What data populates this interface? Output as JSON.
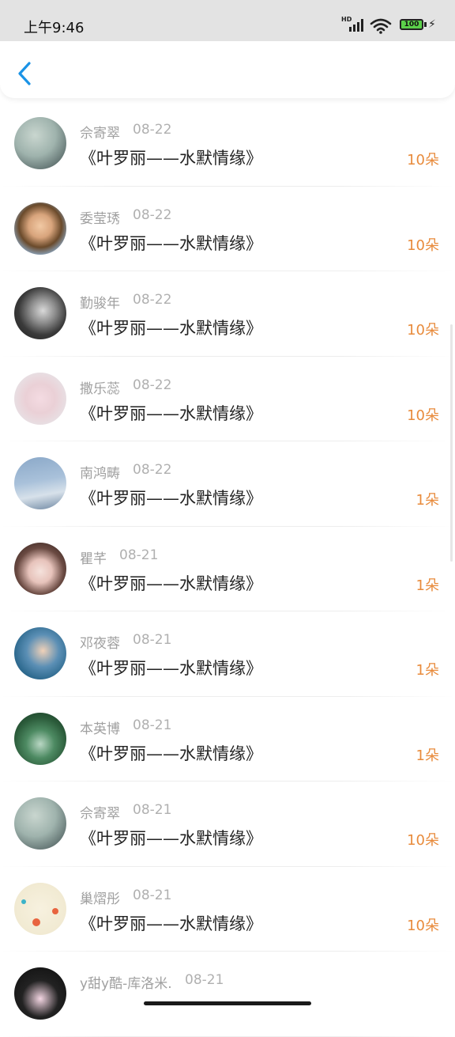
{
  "status": {
    "time": "上午9:46",
    "hd": "HD",
    "battery": "100",
    "icons": [
      "signal-icon",
      "wifi-icon",
      "battery-icon",
      "charging-icon"
    ]
  },
  "header": {
    "back_icon": "chevron-left-icon",
    "accent": "#1a93e6"
  },
  "colors": {
    "count": "#e88b3c",
    "name": "#a0a0a0",
    "title": "#222222"
  },
  "items": [
    {
      "name": "佘寄翠",
      "date": "08-22",
      "title": "《叶罗丽——水默情缘》",
      "count": "10朵",
      "avatar": "sky"
    },
    {
      "name": "委莹琇",
      "date": "08-22",
      "title": "《叶罗丽——水默情缘》",
      "count": "10朵",
      "avatar": "boy"
    },
    {
      "name": "勤骏年",
      "date": "08-22",
      "title": "《叶罗丽——水默情缘》",
      "count": "10朵",
      "avatar": "bw-man"
    },
    {
      "name": "撒乐蕊",
      "date": "08-22",
      "title": "《叶罗丽——水默情缘》",
      "count": "10朵",
      "avatar": "pink"
    },
    {
      "name": "南鸿畴",
      "date": "08-22",
      "title": "《叶罗丽——水默情缘》",
      "count": "1朵",
      "avatar": "blue-sky"
    },
    {
      "name": "瞿芊",
      "date": "08-21",
      "title": "《叶罗丽——水默情缘》",
      "count": "1朵",
      "avatar": "girl"
    },
    {
      "name": "邓夜蓉",
      "date": "08-21",
      "title": "《叶罗丽——水默情缘》",
      "count": "1朵",
      "avatar": "teal"
    },
    {
      "name": "本英博",
      "date": "08-21",
      "title": "《叶罗丽——水默情缘》",
      "count": "1朵",
      "avatar": "forest"
    },
    {
      "name": "佘寄翠",
      "date": "08-21",
      "title": "《叶罗丽——水默情缘》",
      "count": "10朵",
      "avatar": "sky"
    },
    {
      "name": "巢熠彤",
      "date": "08-21",
      "title": "《叶罗丽——水默情缘》",
      "count": "10朵",
      "avatar": "dots"
    },
    {
      "name": "y甜y酷-库洛米.",
      "date": "08-21",
      "title": "",
      "count": "",
      "avatar": "kuromi"
    }
  ]
}
